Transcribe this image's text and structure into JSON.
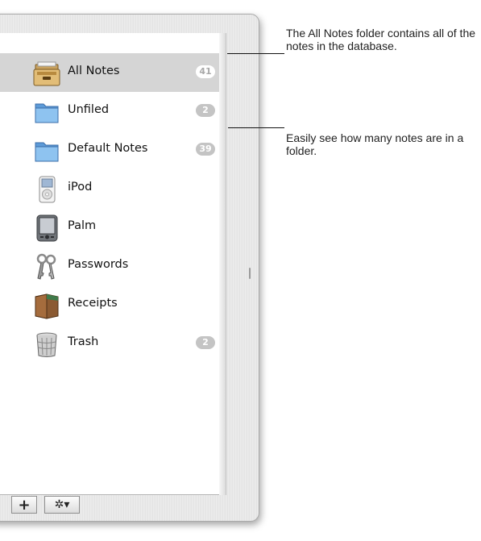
{
  "sidebar": {
    "items": [
      {
        "label": "All Notes",
        "count": "41",
        "icon": "drawer-icon",
        "selected": true
      },
      {
        "label": "Unfiled",
        "count": "2",
        "icon": "folder-icon",
        "selected": false
      },
      {
        "label": "Default Notes",
        "count": "39",
        "icon": "folder-icon",
        "selected": false
      },
      {
        "label": "iPod",
        "count": "",
        "icon": "ipod-icon",
        "selected": false
      },
      {
        "label": "Palm",
        "count": "",
        "icon": "palm-icon",
        "selected": false
      },
      {
        "label": "Passwords",
        "count": "",
        "icon": "keys-icon",
        "selected": false
      },
      {
        "label": "Receipts",
        "count": "",
        "icon": "wallet-icon",
        "selected": false
      },
      {
        "label": "Trash",
        "count": "2",
        "icon": "trash-icon",
        "selected": false
      }
    ]
  },
  "toolbar": {
    "add_label": "+",
    "action_label": "✲▾"
  },
  "callouts": [
    {
      "text": "The All Notes folder contains all of the notes in the database."
    },
    {
      "text": "Easily see how many notes are in a folder."
    }
  ],
  "colors": {
    "selection": "#d5d5d5",
    "badge": "#c4c4c4",
    "folder_blue": "#7fb5e6"
  }
}
